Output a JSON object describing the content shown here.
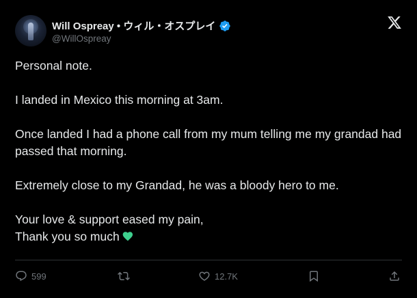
{
  "author": {
    "display_name": "Will Ospreay • ウィル・オスプレイ",
    "handle": "@WillOspreay",
    "verified": true,
    "avatar": "avatar-photo"
  },
  "platform": {
    "logo_icon": "x-logo-icon"
  },
  "tweet": {
    "paragraphs": [
      "Personal note.",
      "I landed in Mexico this morning at 3am.",
      "Once landed I had a phone call from my mum telling me my grandad had passed that morning.",
      "Extremely close to my Grandad, he was a bloody hero to me.",
      "Your love & support eased my pain,"
    ],
    "last_line": "Thank you so much",
    "last_line_emoji": "green-heart-icon"
  },
  "actions": {
    "reply": {
      "icon": "reply-icon",
      "count": "599"
    },
    "retweet": {
      "icon": "retweet-icon",
      "count": ""
    },
    "like": {
      "icon": "heart-icon",
      "count": "12.7K"
    },
    "bookmark": {
      "icon": "bookmark-icon"
    },
    "share": {
      "icon": "share-icon"
    }
  },
  "colors": {
    "background": "#000000",
    "text_primary": "#e7e9ea",
    "text_secondary": "#71767b",
    "verified_blue": "#1d9bf0",
    "divider": "#2f3336",
    "heart_green": "#3ecf8e"
  }
}
